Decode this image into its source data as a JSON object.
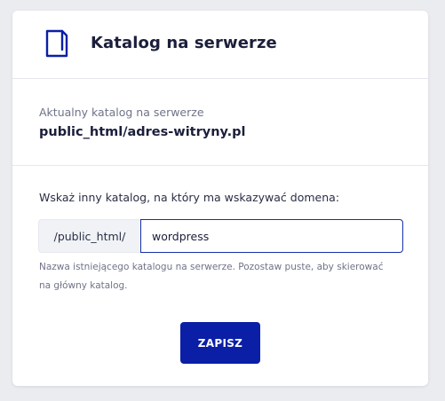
{
  "header": {
    "icon": "document-icon",
    "title": "Katalog na serwerze"
  },
  "current": {
    "label": "Aktualny katalog na serwerze",
    "value": "public_html/adres-witryny.pl"
  },
  "form": {
    "prompt": "Wskaż inny katalog, na który ma wskazywać domena:",
    "prefix": "/public_html/",
    "input_value": "wordpress",
    "hint": "Nazwa istniejącego katalogu na serwerze. Pozostaw puste, aby skierować na główny katalog.",
    "save_label": "ZAPISZ"
  },
  "colors": {
    "accent": "#0a1fa6",
    "input_border": "#1730a8",
    "title": "#1b1f3b",
    "muted": "#6f7387"
  }
}
